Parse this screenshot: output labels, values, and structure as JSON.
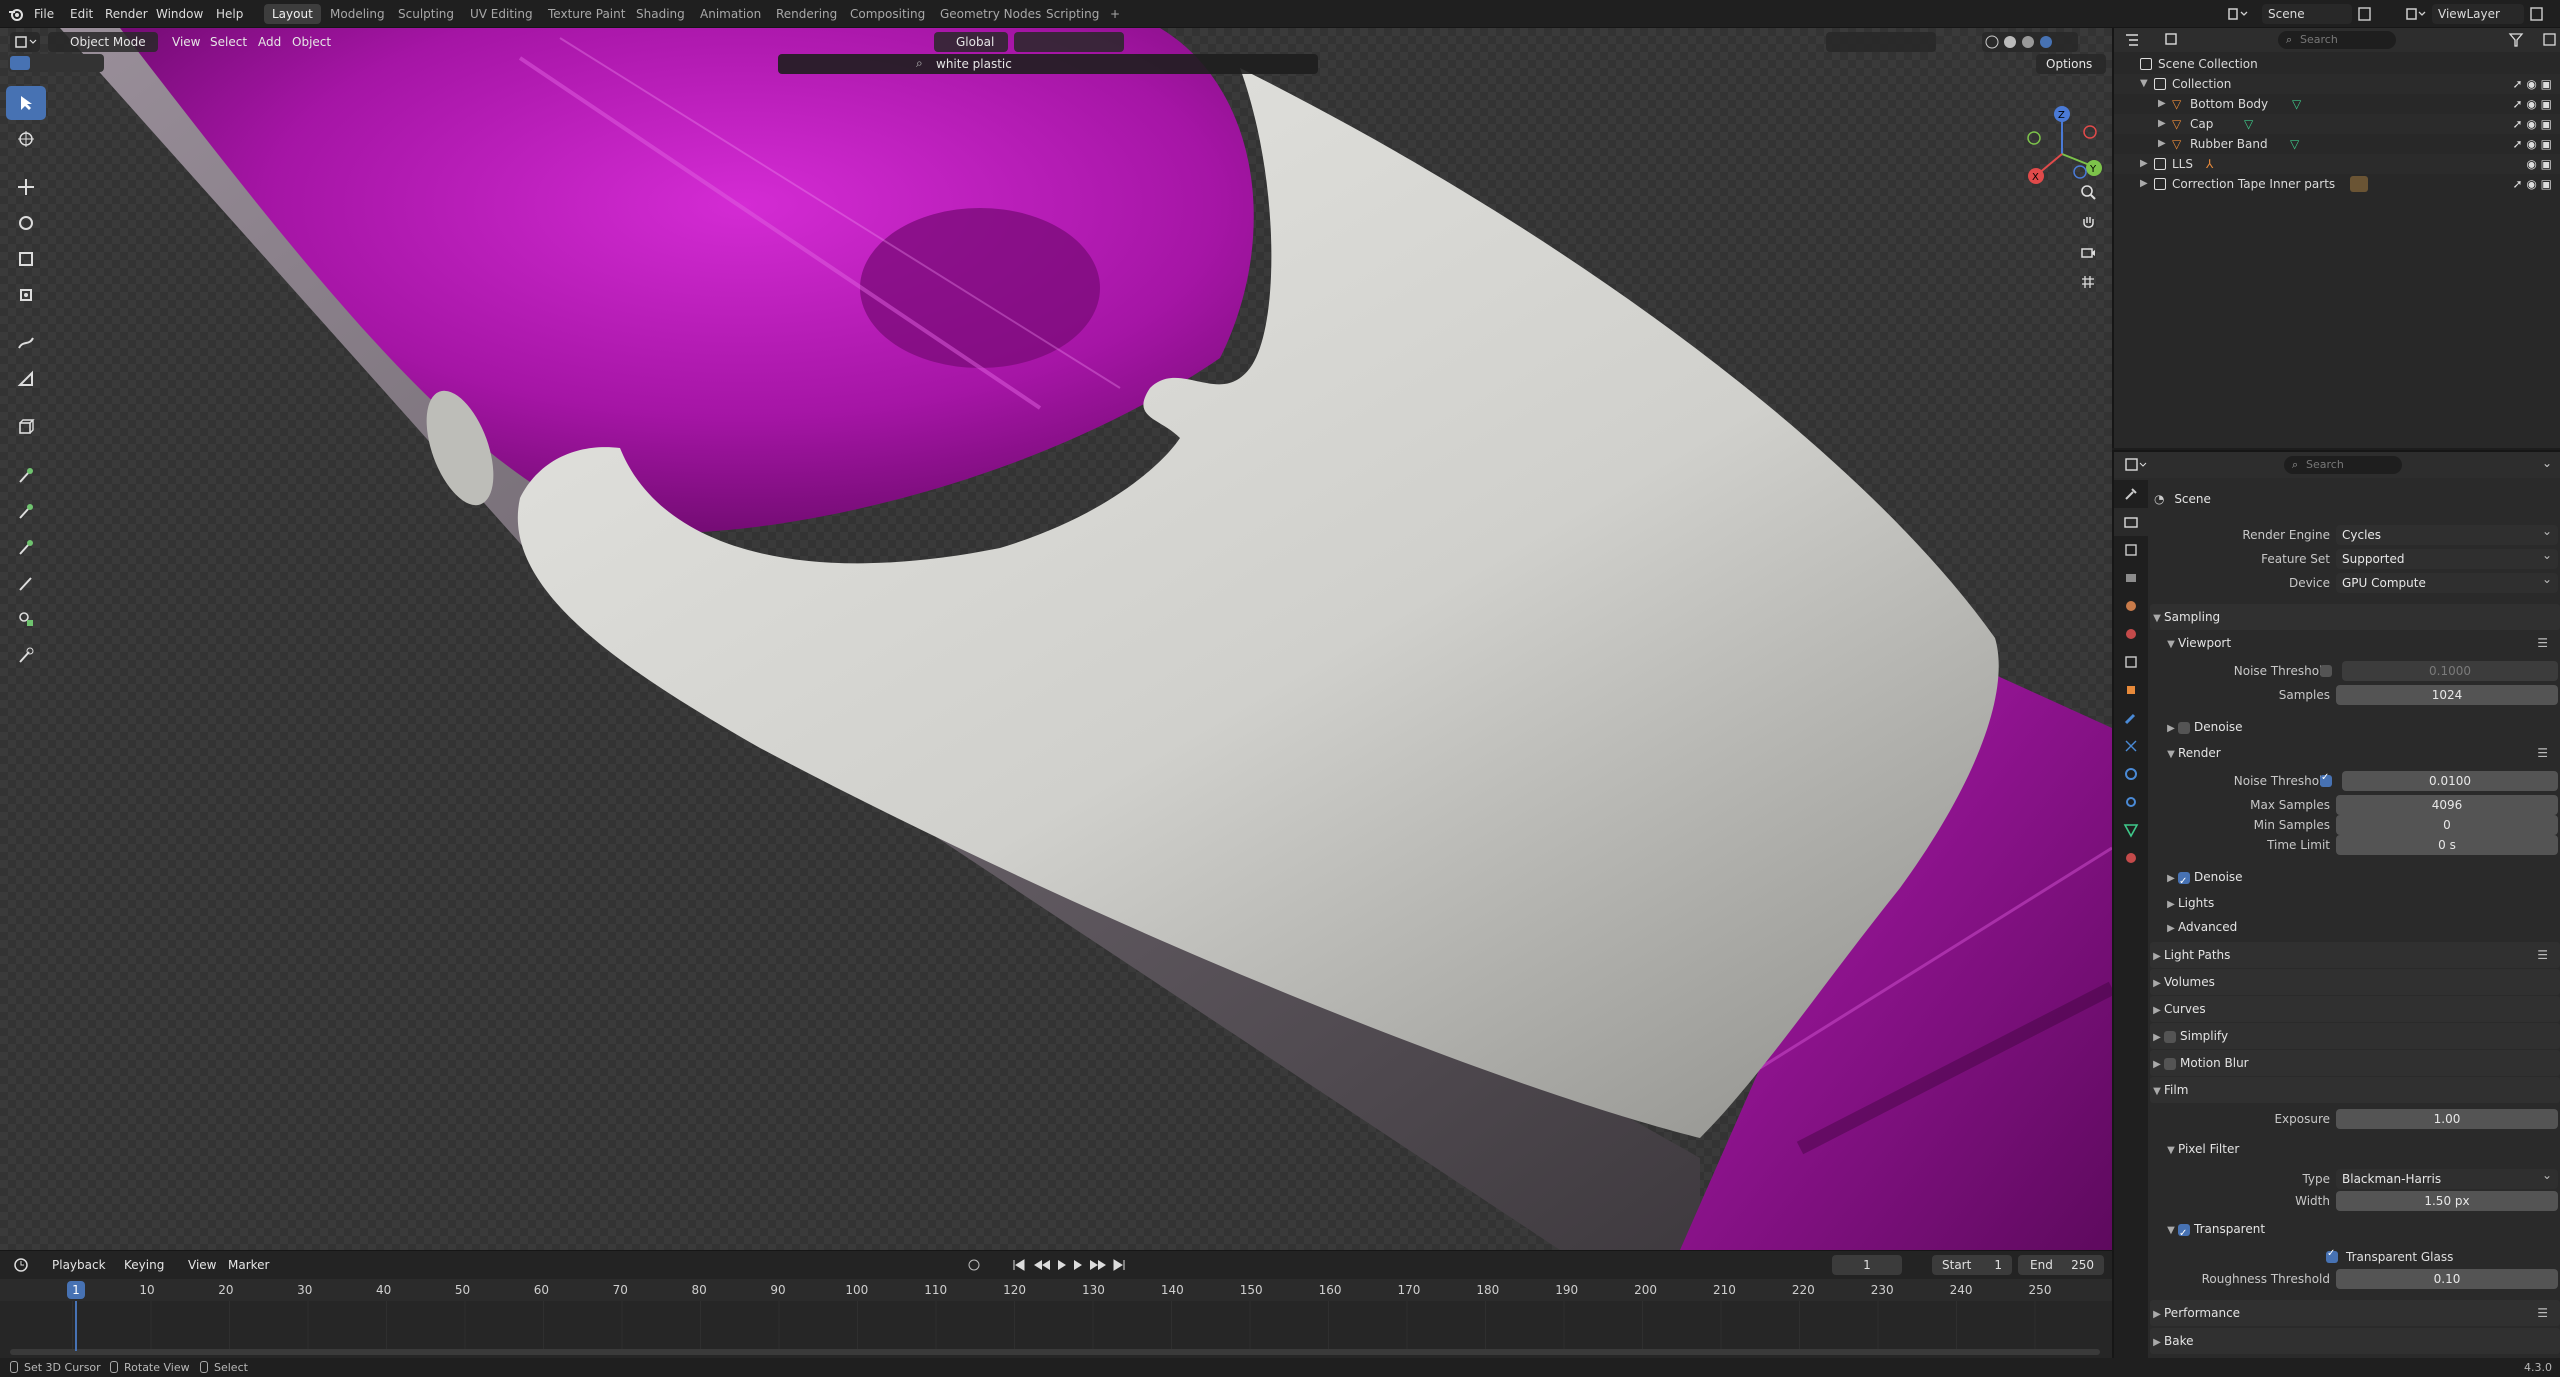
{
  "topbar": {
    "menus": [
      "File",
      "Edit",
      "Render",
      "Window",
      "Help"
    ],
    "workspaces": [
      "Layout",
      "Modeling",
      "Sculpting",
      "UV Editing",
      "Texture Paint",
      "Shading",
      "Animation",
      "Rendering",
      "Compositing",
      "Geometry Nodes",
      "Scripting"
    ],
    "active_workspace": "Layout",
    "add_workspace": "+",
    "scene_name": "Scene",
    "view_layer": "ViewLayer"
  },
  "viewport": {
    "mode": "Object Mode",
    "menus": [
      "View",
      "Select",
      "Add",
      "Object"
    ],
    "transform_orientation": "Global",
    "options_label": "Options",
    "material_search": "white plastic"
  },
  "outliner": {
    "search_placeholder": "Search",
    "scene_collection": "Scene Collection",
    "items": [
      {
        "label": "Collection",
        "indent": 1
      },
      {
        "label": "Bottom Body",
        "indent": 2
      },
      {
        "label": "Cap",
        "indent": 2
      },
      {
        "label": "Rubber Band",
        "indent": 2
      },
      {
        "label": "LLS",
        "indent": 1
      },
      {
        "label": "Correction Tape Inner parts",
        "indent": 1
      }
    ]
  },
  "properties": {
    "search_placeholder": "Search",
    "context": "Scene",
    "render_engine_label": "Render Engine",
    "render_engine": "Cycles",
    "feature_set_label": "Feature Set",
    "feature_set": "Supported",
    "device_label": "Device",
    "device": "GPU Compute",
    "sampling": "Sampling",
    "viewport": "Viewport",
    "noise_threshold_label": "Noise Threshold",
    "viewport_noise_threshold": "0.1000",
    "samples_label": "Samples",
    "viewport_samples": "1024",
    "denoise": "Denoise",
    "render": "Render",
    "render_noise_threshold": "0.0100",
    "max_samples_label": "Max Samples",
    "max_samples": "4096",
    "min_samples_label": "Min Samples",
    "min_samples": "0",
    "time_limit_label": "Time Limit",
    "time_limit": "0 s",
    "lights": "Lights",
    "advanced": "Advanced",
    "light_paths": "Light Paths",
    "volumes": "Volumes",
    "curves": "Curves",
    "simplify": "Simplify",
    "motion_blur": "Motion Blur",
    "film": "Film",
    "exposure_label": "Exposure",
    "exposure": "1.00",
    "pixel_filter": "Pixel Filter",
    "type_label": "Type",
    "filter_type": "Blackman-Harris",
    "width_label": "Width",
    "filter_width": "1.50 px",
    "transparent": "Transparent",
    "transparent_glass": "Transparent Glass",
    "roughness_threshold_label": "Roughness Threshold",
    "roughness_threshold": "0.10",
    "performance": "Performance",
    "bake": "Bake"
  },
  "timeline": {
    "menus": [
      "Playback",
      "Keying",
      "View",
      "Marker"
    ],
    "current_frame": "1",
    "start_label": "Start",
    "start": "1",
    "end_label": "End",
    "end": "250",
    "ticks": [
      "1",
      "10",
      "20",
      "30",
      "40",
      "50",
      "60",
      "70",
      "80",
      "90",
      "100",
      "110",
      "120",
      "130",
      "140",
      "150",
      "160",
      "170",
      "180",
      "190",
      "200",
      "210",
      "220",
      "230",
      "240",
      "250"
    ]
  },
  "statusbar": {
    "hint1": "Set 3D Cursor",
    "hint2": "Rotate View",
    "hint3": "Select",
    "version": "4.3.0"
  },
  "colors": {
    "accent": "#4772b3",
    "magenta": "#c81ec8",
    "white_plastic": "#d9d9d6",
    "outliner_icon": "#e88a3a",
    "mesh_icon": "#3fc98a"
  }
}
